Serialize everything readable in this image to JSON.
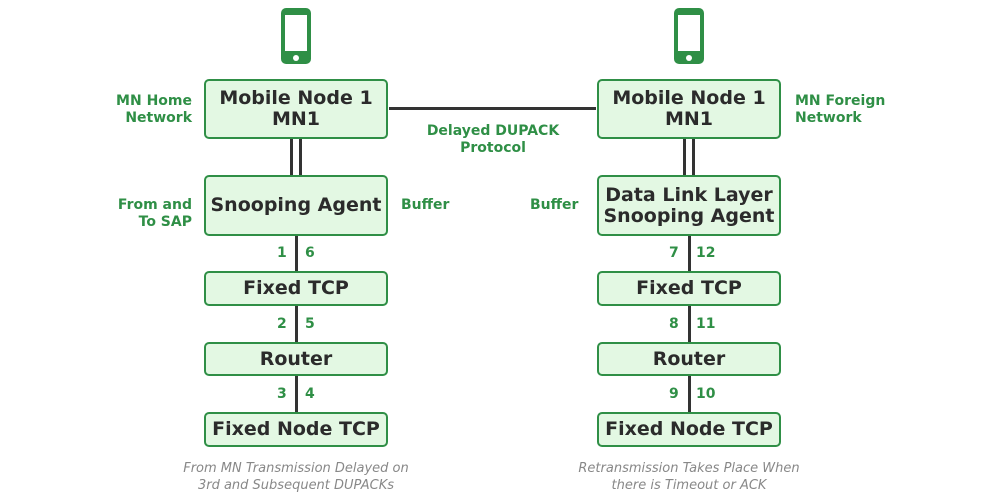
{
  "left": {
    "node": "Mobile Node 1\nMN1",
    "network": "MN Home\nNetwork",
    "agent": "Snooping Agent",
    "agent_side": "From and\nTo SAP",
    "buffer": "Buffer",
    "fixed_tcp": "Fixed TCP",
    "router": "Router",
    "fixed_node": "Fixed Node TCP",
    "nums": [
      "1",
      "6",
      "2",
      "5",
      "3",
      "4"
    ],
    "note": "From MN Transmission Delayed on\n3rd and Subsequent DUPACKs"
  },
  "right": {
    "node": "Mobile Node 1\nMN1",
    "network": "MN Foreign\nNetwork",
    "agent": "Data Link Layer\nSnooping Agent",
    "buffer": "Buffer",
    "fixed_tcp": "Fixed TCP",
    "router": "Router",
    "fixed_node": "Fixed Node TCP",
    "nums": [
      "7",
      "12",
      "8",
      "11",
      "9",
      "10"
    ],
    "note": "Retransmission Takes Place When\nthere is Timeout or ACK"
  },
  "link_label": "Delayed DUPACK\nProtocol",
  "icons": [
    "mobile-phone-icon"
  ],
  "colors": {
    "accent": "#2f8f46",
    "fill": "#e3f8e3"
  }
}
